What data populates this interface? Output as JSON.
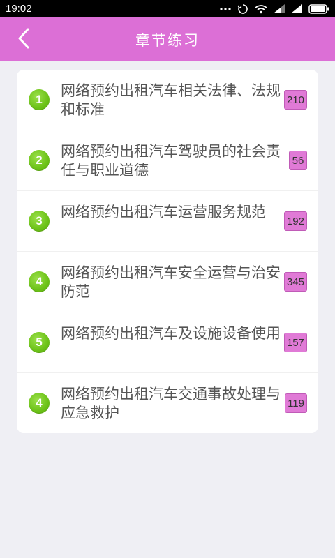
{
  "status_bar": {
    "time": "19:02"
  },
  "header": {
    "title": "章节练习"
  },
  "chapters": [
    {
      "number": "1",
      "title": "网络预约出租汽车相关法律、法规和标准",
      "count": "210"
    },
    {
      "number": "2",
      "title": "网络预约出租汽车驾驶员的社会责任与职业道德",
      "count": "56"
    },
    {
      "number": "3",
      "title": "网络预约出租汽车运营服务规范",
      "count": "192"
    },
    {
      "number": "4",
      "title": "网络预约出租汽车安全运营与治安防范",
      "count": "345"
    },
    {
      "number": "5",
      "title": "网络预约出租汽车及设施设备使用",
      "count": "157"
    },
    {
      "number": "4",
      "title": "网络预约出租汽车交通事故处理与应急救护",
      "count": "119"
    }
  ],
  "colors": {
    "header_bg": "#dc6fd6",
    "number_badge": "#6cc218",
    "count_badge": "#e07ad6",
    "page_bg": "#efeff4"
  }
}
